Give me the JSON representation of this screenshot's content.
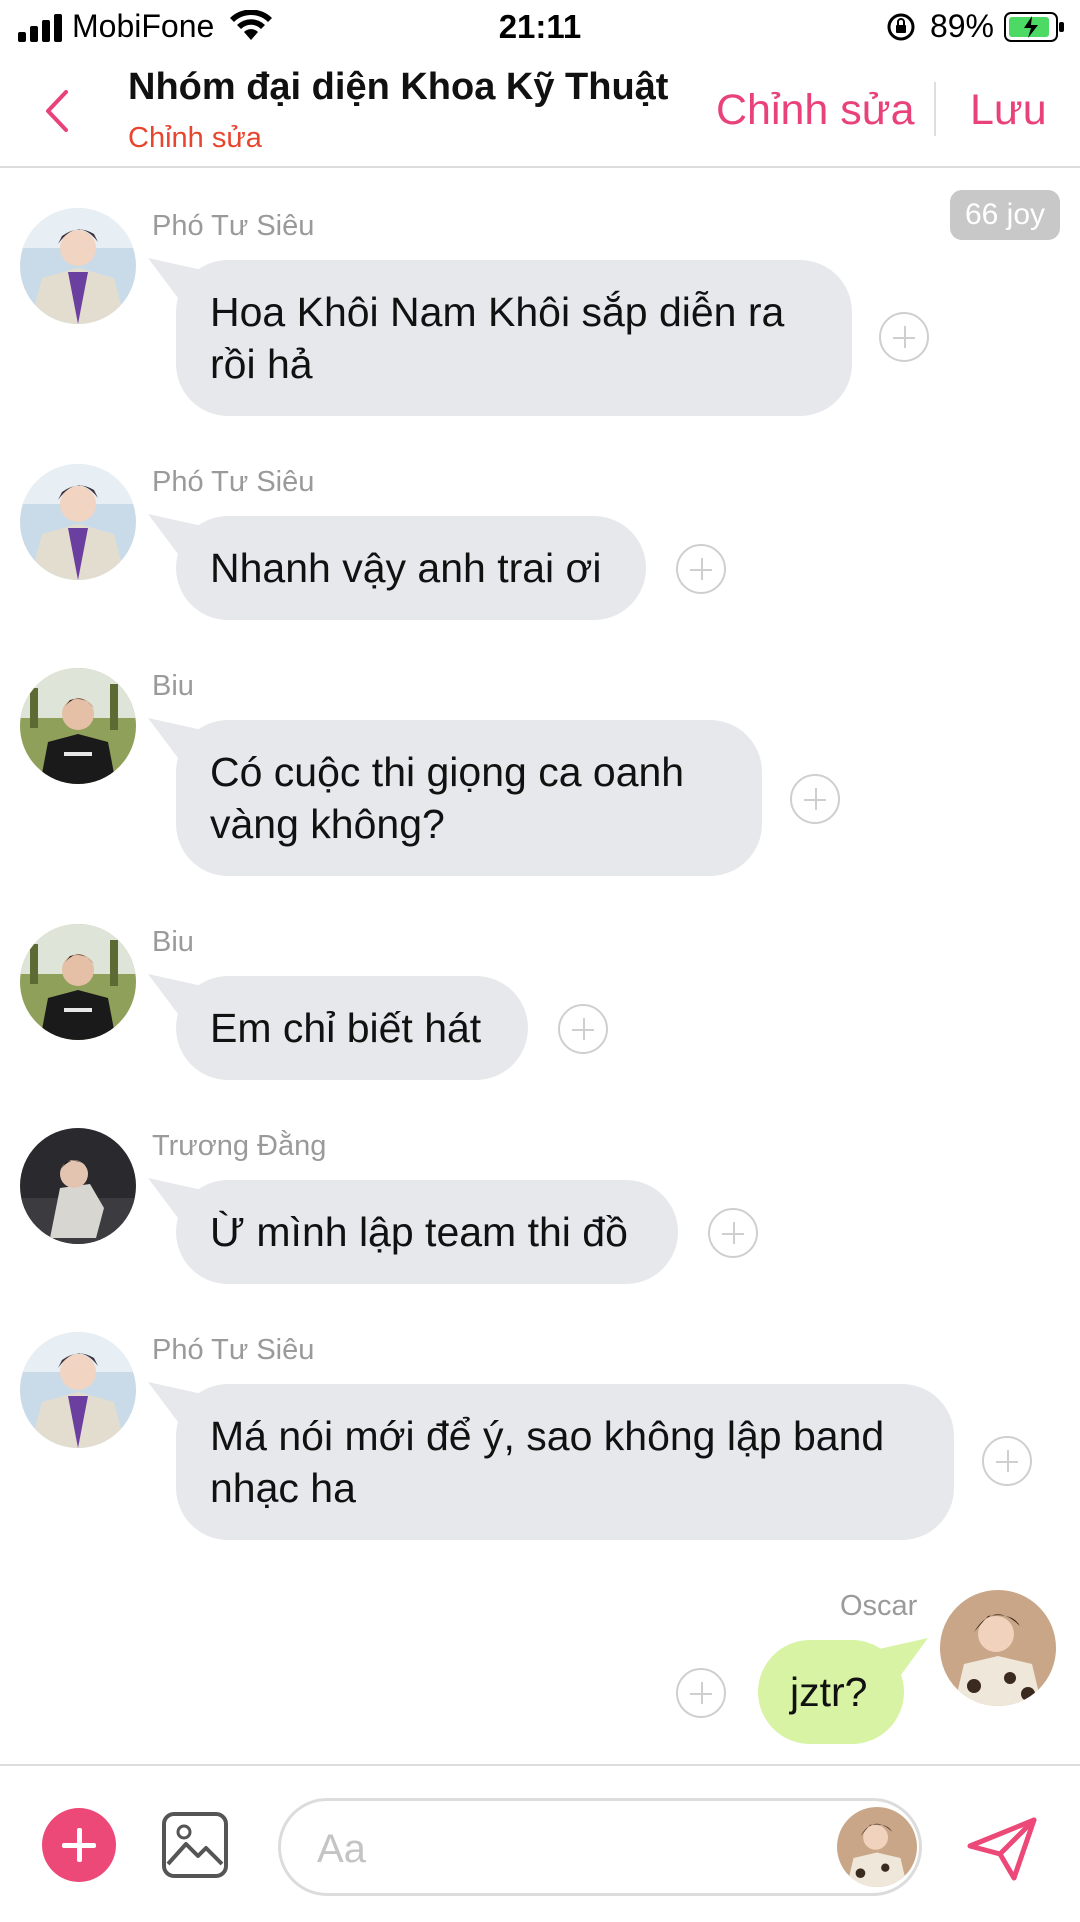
{
  "status_bar": {
    "carrier": "MobiFone",
    "time": "21:11",
    "battery": "89%",
    "icons": [
      "signal-icon",
      "wifi-icon",
      "orientation-lock-icon",
      "battery-charging-icon"
    ]
  },
  "header": {
    "title": "Nhóm đại diện Khoa Kỹ Thuật",
    "subtitle": "Chỉnh sửa",
    "edit_label": "Chỉnh sửa",
    "save_label": "Lưu",
    "accent_color": "#e9427a"
  },
  "joy_badge": "66 joy",
  "messages": [
    {
      "sender": "Phó Tư Siêu",
      "text": "Hoa Khôi Nam Khôi sắp diễn ra rồi hả"
    },
    {
      "sender": "Phó Tư Siêu",
      "text": "Nhanh vậy anh trai ơi"
    },
    {
      "sender": "Biu",
      "text": "Có cuộc thi giọng ca oanh vàng không?"
    },
    {
      "sender": "Biu",
      "text": "Em chỉ biết hát"
    },
    {
      "sender": "Trương Đằng",
      "text": "Ừ mình lập team thi đồ"
    },
    {
      "sender": "Phó Tư Siêu",
      "text": "Má nói mới để ý, sao không lập band nhạc ha"
    },
    {
      "sender": "Oscar",
      "text": "jztr?",
      "mine": true
    }
  ],
  "composer": {
    "placeholder": "Aa"
  }
}
